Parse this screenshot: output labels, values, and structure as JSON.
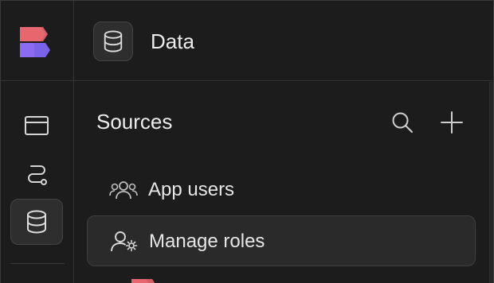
{
  "app": {
    "brand_logo": "app-logo"
  },
  "rail": {
    "items": [
      {
        "name": "pages",
        "icon": "window-icon"
      },
      {
        "name": "automations",
        "icon": "route-icon"
      },
      {
        "name": "data",
        "icon": "database-icon",
        "active": true
      }
    ]
  },
  "header": {
    "title": "Data",
    "icon": "database-icon"
  },
  "sources": {
    "title": "Sources",
    "search_icon": "search-icon",
    "add_icon": "plus-icon",
    "items": [
      {
        "label": "App users",
        "icon": "users-group-icon"
      },
      {
        "label": "Manage roles",
        "icon": "user-settings-icon",
        "selected": true
      }
    ]
  },
  "colors": {
    "background": "#1c1c1c",
    "logo_red": "#e86a6a",
    "logo_purple": "#8b6cf0",
    "active_bg": "#2e2e2e"
  }
}
